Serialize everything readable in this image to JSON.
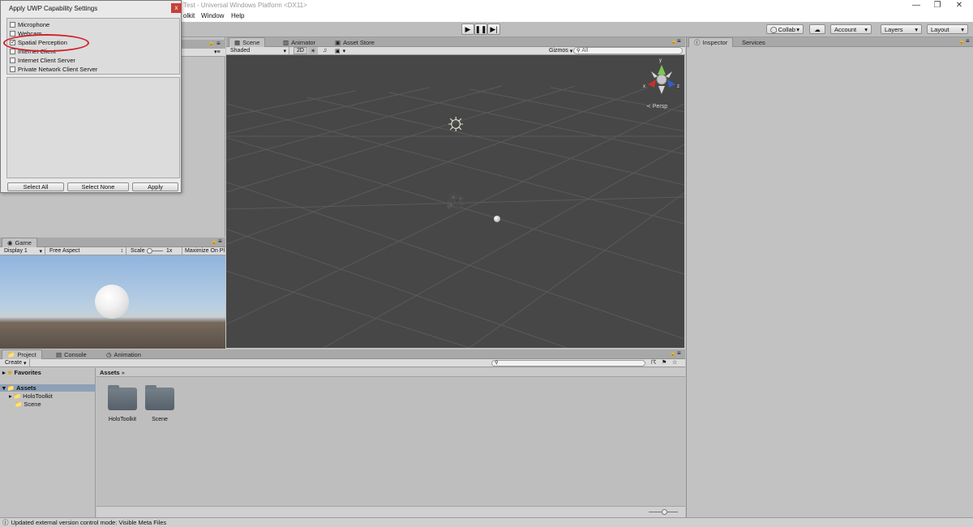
{
  "window": {
    "title": "Test - Universal Windows Platform <DX11>"
  },
  "menubar": {
    "items": [
      "olkit",
      "Window",
      "Help"
    ]
  },
  "toolbar": {
    "collab_label": "Collab",
    "account_label": "Account",
    "layers_label": "Layers",
    "layout_label": "Layout"
  },
  "scene_panel": {
    "tabs": [
      "Scene",
      "Animator",
      "Asset Store"
    ],
    "shading_mode": "Shaded",
    "mode_2d": "2D",
    "gizmos_label": "Gizmos",
    "search_placeholder": "All",
    "persp_label": "Persp",
    "axis_x": "x",
    "axis_y": "y",
    "axis_z": "z"
  },
  "game_panel": {
    "tab": "Game",
    "display": "Display 1",
    "aspect": "Free Aspect",
    "scale_label": "Scale",
    "scale_value": "1x",
    "maximize_label": "Maximize On Pl"
  },
  "inspector_panel": {
    "tabs": [
      "Inspector",
      "Services"
    ]
  },
  "project_panel": {
    "tabs": [
      "Project",
      "Console",
      "Animation"
    ],
    "create_label": "Create",
    "favorites_label": "Favorites",
    "tree": [
      "Assets",
      "HoloToolkit",
      "Scene"
    ],
    "breadcrumb": "Assets",
    "assets": [
      "HoloToolkit",
      "Scene"
    ]
  },
  "dialog": {
    "title": "Apply UWP Capability Settings",
    "close": "x",
    "capabilities": [
      {
        "label": "Microphone",
        "checked": false
      },
      {
        "label": "Webcam",
        "checked": false
      },
      {
        "label": "Spatial Perception",
        "checked": true
      },
      {
        "label": "Internet Client",
        "checked": false
      },
      {
        "label": "Internet Client Server",
        "checked": false
      },
      {
        "label": "Private Network Client Server",
        "checked": false
      }
    ],
    "buttons": {
      "select_all": "Select All",
      "select_none": "Select None",
      "apply": "Apply"
    },
    "highlight_color": "#d0212a"
  },
  "status_bar": {
    "message": "Updated external version control mode: Visible Meta Files"
  }
}
